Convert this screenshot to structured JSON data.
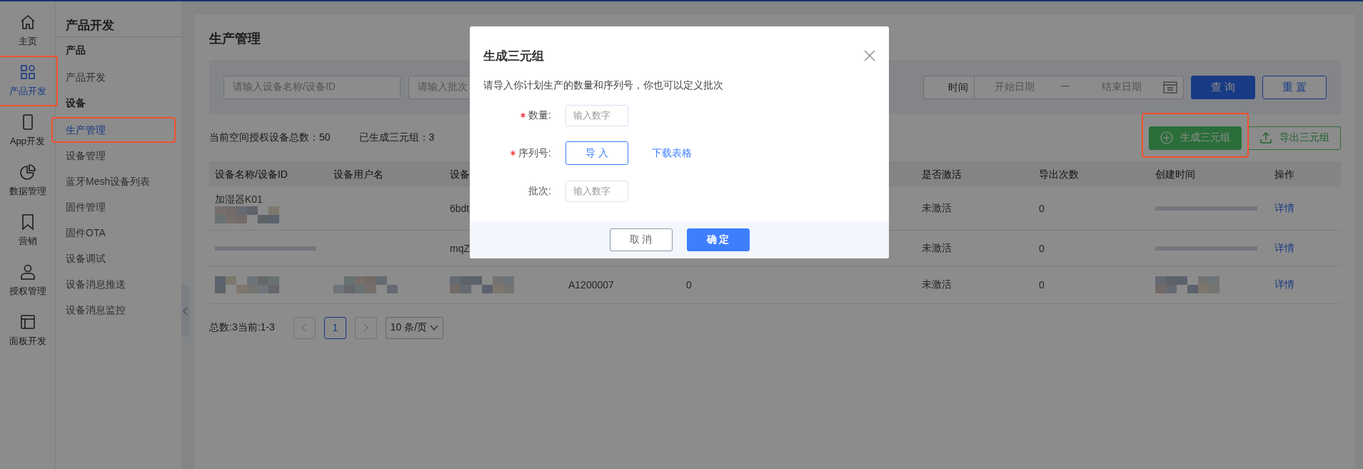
{
  "rail": [
    {
      "label": "主页",
      "selected": false,
      "highlighted": false
    },
    {
      "label": "产品开发",
      "selected": true,
      "highlighted": true
    },
    {
      "label": "App开发",
      "selected": false,
      "highlighted": false
    },
    {
      "label": "数据管理",
      "selected": false,
      "highlighted": false
    },
    {
      "label": "营销",
      "selected": false,
      "highlighted": false
    },
    {
      "label": "授权管理",
      "selected": false,
      "highlighted": false
    },
    {
      "label": "面板开发",
      "selected": false,
      "highlighted": false
    }
  ],
  "subnav": {
    "title": "产品开发",
    "groups": [
      {
        "heading": "产品",
        "items": [
          {
            "label": "产品开发",
            "selected": false,
            "highlighted": false
          }
        ]
      },
      {
        "heading": "设备",
        "items": [
          {
            "label": "生产管理",
            "selected": true,
            "highlighted": true
          },
          {
            "label": "设备管理",
            "selected": false,
            "highlighted": false
          },
          {
            "label": "蓝牙Mesh设备列表",
            "selected": false,
            "highlighted": false
          },
          {
            "label": "固件管理",
            "selected": false,
            "highlighted": false
          },
          {
            "label": "固件OTA",
            "selected": false,
            "highlighted": false
          },
          {
            "label": "设备调试",
            "selected": false,
            "highlighted": false
          },
          {
            "label": "设备消息推送",
            "selected": false,
            "highlighted": false
          },
          {
            "label": "设备消息监控",
            "selected": false,
            "highlighted": false
          }
        ]
      }
    ]
  },
  "page": {
    "title": "生产管理"
  },
  "filters": {
    "name_field": {
      "placeholder": "请输入设备名称/设备ID"
    },
    "batch_field": {
      "placeholder": "请输入批次"
    },
    "date_range": {
      "label": "时间",
      "start_placeholder": "开始日期",
      "separator": "一",
      "end_placeholder": "结束日期"
    },
    "buttons": [
      {
        "label": "查 询",
        "kind": "primary"
      },
      {
        "label": "重 置",
        "kind": "outline"
      }
    ]
  },
  "stats": [
    "当前空间授权设备总数：50",
    "已生成三元组：3"
  ],
  "actions": [
    {
      "label": "生成三元组",
      "kind": "primary",
      "highlighted": true
    },
    {
      "label": "导出三元组",
      "kind": "outline",
      "highlighted": false
    }
  ],
  "table": {
    "columns": [
      "设备名称/设备ID",
      "设备用户名",
      "设备",
      null,
      null,
      "是否激活",
      "导出次数",
      "创建时间",
      "操作"
    ],
    "rows": [
      [
        {
          "kind": "text_mosaic",
          "text": "加湿器K01"
        },
        null,
        {
          "kind": "text",
          "text": "6bdt"
        },
        null,
        null,
        {
          "kind": "text",
          "text": "未激活"
        },
        {
          "kind": "text",
          "text": "0"
        },
        {
          "kind": "bar"
        },
        {
          "kind": "link",
          "text": "详情"
        }
      ],
      [
        {
          "kind": "bar"
        },
        null,
        {
          "kind": "text",
          "text": "mqZ"
        },
        null,
        null,
        {
          "kind": "text",
          "text": "未激活"
        },
        {
          "kind": "text",
          "text": "0"
        },
        {
          "kind": "bar"
        },
        {
          "kind": "link",
          "text": "详情"
        }
      ],
      [
        {
          "kind": "mosaic"
        },
        {
          "kind": "mosaic"
        },
        {
          "kind": "mosaic"
        },
        {
          "kind": "text",
          "text": "A1200007"
        },
        {
          "kind": "text",
          "text": "0"
        },
        {
          "kind": "text",
          "text": "未激活"
        },
        {
          "kind": "text",
          "text": "0"
        },
        {
          "kind": "mosaic"
        },
        {
          "kind": "link",
          "text": "详情"
        }
      ]
    ]
  },
  "pagination": {
    "summary": "总数:3当前:1-3",
    "prev": {
      "disabled": true
    },
    "pages": [
      {
        "label": "1",
        "selected": true
      }
    ],
    "next": {
      "disabled": true
    },
    "page_size": "10 条/页"
  },
  "modal": {
    "title": "生成三元组",
    "description": "请导入你计划生产的数量和序列号，你也可以定义批次",
    "fields": [
      {
        "kind": "input",
        "label": "数量:",
        "required": true,
        "placeholder": "输入数字"
      },
      {
        "kind": "upload",
        "label": "序列号:",
        "required": true,
        "button": "导 入",
        "link": "下载表格"
      },
      {
        "kind": "input",
        "label": "批次:",
        "required": false,
        "placeholder": "输入数字"
      }
    ],
    "buttons": [
      {
        "label": "取 消",
        "kind": "outline"
      },
      {
        "label": "确 定",
        "kind": "primary"
      }
    ]
  }
}
